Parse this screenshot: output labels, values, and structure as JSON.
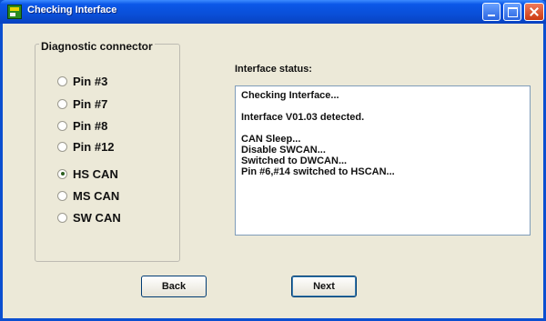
{
  "window": {
    "title": "Checking Interface"
  },
  "diagnostic": {
    "group_label": "Diagnostic connector",
    "options": [
      {
        "label": "Pin #3",
        "checked": false
      },
      {
        "label": "Pin #7",
        "checked": false
      },
      {
        "label": "Pin #8",
        "checked": false
      },
      {
        "label": "Pin #12",
        "checked": false
      },
      {
        "label": "HS CAN",
        "checked": true
      },
      {
        "label": "MS CAN",
        "checked": false
      },
      {
        "label": "SW CAN",
        "checked": false
      }
    ]
  },
  "status": {
    "label": "Interface status:",
    "lines": [
      "Checking Interface...",
      "",
      "Interface V01.03 detected.",
      "",
      "CAN Sleep...",
      "Disable SWCAN...",
      "Switched to DWCAN...",
      "Pin #6,#14 switched to HSCAN..."
    ]
  },
  "buttons": {
    "back": "Back",
    "next": "Next"
  },
  "colors": {
    "titlebar": "#0b57e8",
    "client_bg": "#ece9d8"
  },
  "icons": {
    "app": "app-icon",
    "minimize": "minimize-icon",
    "maximize": "maximize-icon",
    "close": "close-icon"
  }
}
